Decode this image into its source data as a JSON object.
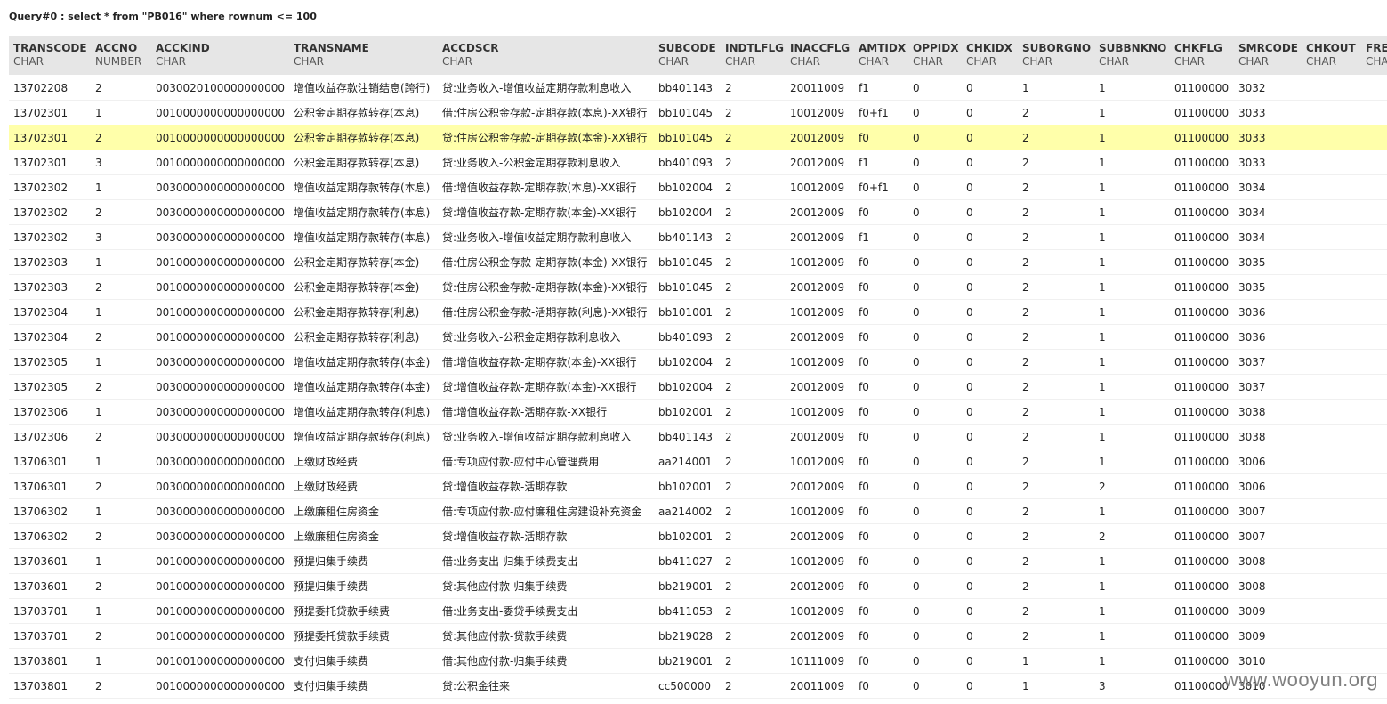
{
  "query": {
    "title": "Query#0 : select * from \"PB016\" where rownum <= 100"
  },
  "table": {
    "columns": [
      {
        "name": "TRANSCODE",
        "type": "CHAR"
      },
      {
        "name": "ACCNO",
        "type": "NUMBER"
      },
      {
        "name": "ACCKIND",
        "type": "CHAR"
      },
      {
        "name": "TRANSNAME",
        "type": "CHAR"
      },
      {
        "name": "ACCDSCR",
        "type": "CHAR"
      },
      {
        "name": "SUBCODE",
        "type": "CHAR"
      },
      {
        "name": "INDTLFLG",
        "type": "CHAR"
      },
      {
        "name": "INACCFLG",
        "type": "CHAR"
      },
      {
        "name": "AMTIDX",
        "type": "CHAR"
      },
      {
        "name": "OPPIDX",
        "type": "CHAR"
      },
      {
        "name": "CHKIDX",
        "type": "CHAR"
      },
      {
        "name": "SUBORGNO",
        "type": "CHAR"
      },
      {
        "name": "SUBBNKNO",
        "type": "CHAR"
      },
      {
        "name": "CHKFLG",
        "type": "CHAR"
      },
      {
        "name": "SMRCODE",
        "type": "CHAR"
      },
      {
        "name": "CHKOUT",
        "type": "CHAR"
      },
      {
        "name": "FRE",
        "type": "CHA"
      }
    ],
    "rows": [
      [
        "13702208",
        "2",
        "0030020100000000000",
        "增值收益存款注销结息(跨行)",
        "贷:业务收入-增值收益定期存款利息收入",
        "bb401143",
        "2",
        "20011009",
        "f1",
        "0",
        "0",
        "1",
        "1",
        "01100000",
        "3032",
        "",
        ""
      ],
      [
        "13702301",
        "1",
        "0010000000000000000",
        "公积金定期存款转存(本息)",
        "借:住房公积金存款-定期存款(本息)-XX银行",
        "bb101045",
        "2",
        "10012009",
        "f0+f1",
        "0",
        "0",
        "2",
        "1",
        "01100000",
        "3033",
        "",
        ""
      ],
      [
        "13702301",
        "2",
        "0010000000000000000",
        "公积金定期存款转存(本息)",
        "贷:住房公积金存款-定期存款(本金)-XX银行",
        "bb101045",
        "2",
        "20012009",
        "f0",
        "0",
        "0",
        "2",
        "1",
        "01100000",
        "3033",
        "",
        ""
      ],
      [
        "13702301",
        "3",
        "0010000000000000000",
        "公积金定期存款转存(本息)",
        "贷:业务收入-公积金定期存款利息收入",
        "bb401093",
        "2",
        "20012009",
        "f1",
        "0",
        "0",
        "2",
        "1",
        "01100000",
        "3033",
        "",
        ""
      ],
      [
        "13702302",
        "1",
        "0030000000000000000",
        "增值收益定期存款转存(本息)",
        "借:增值收益存款-定期存款(本息)-XX银行",
        "bb102004",
        "2",
        "10012009",
        "f0+f1",
        "0",
        "0",
        "2",
        "1",
        "01100000",
        "3034",
        "",
        ""
      ],
      [
        "13702302",
        "2",
        "0030000000000000000",
        "增值收益定期存款转存(本息)",
        "贷:增值收益存款-定期存款(本金)-XX银行",
        "bb102004",
        "2",
        "20012009",
        "f0",
        "0",
        "0",
        "2",
        "1",
        "01100000",
        "3034",
        "",
        ""
      ],
      [
        "13702302",
        "3",
        "0030000000000000000",
        "增值收益定期存款转存(本息)",
        "贷:业务收入-增值收益定期存款利息收入",
        "bb401143",
        "2",
        "20012009",
        "f1",
        "0",
        "0",
        "2",
        "1",
        "01100000",
        "3034",
        "",
        ""
      ],
      [
        "13702303",
        "1",
        "0010000000000000000",
        "公积金定期存款转存(本金)",
        "借:住房公积金存款-定期存款(本金)-XX银行",
        "bb101045",
        "2",
        "10012009",
        "f0",
        "0",
        "0",
        "2",
        "1",
        "01100000",
        "3035",
        "",
        ""
      ],
      [
        "13702303",
        "2",
        "0010000000000000000",
        "公积金定期存款转存(本金)",
        "贷:住房公积金存款-定期存款(本金)-XX银行",
        "bb101045",
        "2",
        "20012009",
        "f0",
        "0",
        "0",
        "2",
        "1",
        "01100000",
        "3035",
        "",
        ""
      ],
      [
        "13702304",
        "1",
        "0010000000000000000",
        "公积金定期存款转存(利息)",
        "借:住房公积金存款-活期存款(利息)-XX银行",
        "bb101001",
        "2",
        "10012009",
        "f0",
        "0",
        "0",
        "2",
        "1",
        "01100000",
        "3036",
        "",
        ""
      ],
      [
        "13702304",
        "2",
        "0010000000000000000",
        "公积金定期存款转存(利息)",
        "贷:业务收入-公积金定期存款利息收入",
        "bb401093",
        "2",
        "20012009",
        "f0",
        "0",
        "0",
        "2",
        "1",
        "01100000",
        "3036",
        "",
        ""
      ],
      [
        "13702305",
        "1",
        "0030000000000000000",
        "增值收益定期存款转存(本金)",
        "借:增值收益存款-定期存款(本金)-XX银行",
        "bb102004",
        "2",
        "10012009",
        "f0",
        "0",
        "0",
        "2",
        "1",
        "01100000",
        "3037",
        "",
        ""
      ],
      [
        "13702305",
        "2",
        "0030000000000000000",
        "增值收益定期存款转存(本金)",
        "贷:增值收益存款-定期存款(本金)-XX银行",
        "bb102004",
        "2",
        "20012009",
        "f0",
        "0",
        "0",
        "2",
        "1",
        "01100000",
        "3037",
        "",
        ""
      ],
      [
        "13702306",
        "1",
        "0030000000000000000",
        "增值收益定期存款转存(利息)",
        "借:增值收益存款-活期存款-XX银行",
        "bb102001",
        "2",
        "10012009",
        "f0",
        "0",
        "0",
        "2",
        "1",
        "01100000",
        "3038",
        "",
        ""
      ],
      [
        "13702306",
        "2",
        "0030000000000000000",
        "增值收益定期存款转存(利息)",
        "贷:业务收入-增值收益定期存款利息收入",
        "bb401143",
        "2",
        "20012009",
        "f0",
        "0",
        "0",
        "2",
        "1",
        "01100000",
        "3038",
        "",
        ""
      ],
      [
        "13706301",
        "1",
        "0030000000000000000",
        "上缴财政经费",
        "借:专项应付款-应付中心管理费用",
        "aa214001",
        "2",
        "10012009",
        "f0",
        "0",
        "0",
        "2",
        "1",
        "01100000",
        "3006",
        "",
        ""
      ],
      [
        "13706301",
        "2",
        "0030000000000000000",
        "上缴财政经费",
        "贷:增值收益存款-活期存款",
        "bb102001",
        "2",
        "20012009",
        "f0",
        "0",
        "0",
        "2",
        "2",
        "01100000",
        "3006",
        "",
        ""
      ],
      [
        "13706302",
        "1",
        "0030000000000000000",
        "上缴廉租住房资金",
        "借:专项应付款-应付廉租住房建设补充资金",
        "aa214002",
        "2",
        "10012009",
        "f0",
        "0",
        "0",
        "2",
        "1",
        "01100000",
        "3007",
        "",
        ""
      ],
      [
        "13706302",
        "2",
        "0030000000000000000",
        "上缴廉租住房资金",
        "贷:增值收益存款-活期存款",
        "bb102001",
        "2",
        "20012009",
        "f0",
        "0",
        "0",
        "2",
        "2",
        "01100000",
        "3007",
        "",
        ""
      ],
      [
        "13703601",
        "1",
        "0010000000000000000",
        "预提归集手续费",
        "借:业务支出-归集手续费支出",
        "bb411027",
        "2",
        "10012009",
        "f0",
        "0",
        "0",
        "2",
        "1",
        "01100000",
        "3008",
        "",
        ""
      ],
      [
        "13703601",
        "2",
        "0010000000000000000",
        "预提归集手续费",
        "贷:其他应付款-归集手续费",
        "bb219001",
        "2",
        "20012009",
        "f0",
        "0",
        "0",
        "2",
        "1",
        "01100000",
        "3008",
        "",
        ""
      ],
      [
        "13703701",
        "1",
        "0010000000000000000",
        "预提委托贷款手续费",
        "借:业务支出-委贷手续费支出",
        "bb411053",
        "2",
        "10012009",
        "f0",
        "0",
        "0",
        "2",
        "1",
        "01100000",
        "3009",
        "",
        ""
      ],
      [
        "13703701",
        "2",
        "0010000000000000000",
        "预提委托贷款手续费",
        "贷:其他应付款-贷款手续费",
        "bb219028",
        "2",
        "20012009",
        "f0",
        "0",
        "0",
        "2",
        "1",
        "01100000",
        "3009",
        "",
        ""
      ],
      [
        "13703801",
        "1",
        "0010010000000000000",
        "支付归集手续费",
        "借:其他应付款-归集手续费",
        "bb219001",
        "2",
        "10111009",
        "f0",
        "0",
        "0",
        "1",
        "1",
        "01100000",
        "3010",
        "",
        ""
      ],
      [
        "13703801",
        "2",
        "0010000000000000000",
        "支付归集手续费",
        "贷:公积金往来",
        "cc500000",
        "2",
        "20011009",
        "f0",
        "0",
        "0",
        "1",
        "3",
        "01100000",
        "3010",
        "",
        ""
      ]
    ],
    "highlighted_row": 2,
    "highlight_color": "#ffffaa"
  },
  "watermark": {
    "text": "www.wooyun.org"
  }
}
